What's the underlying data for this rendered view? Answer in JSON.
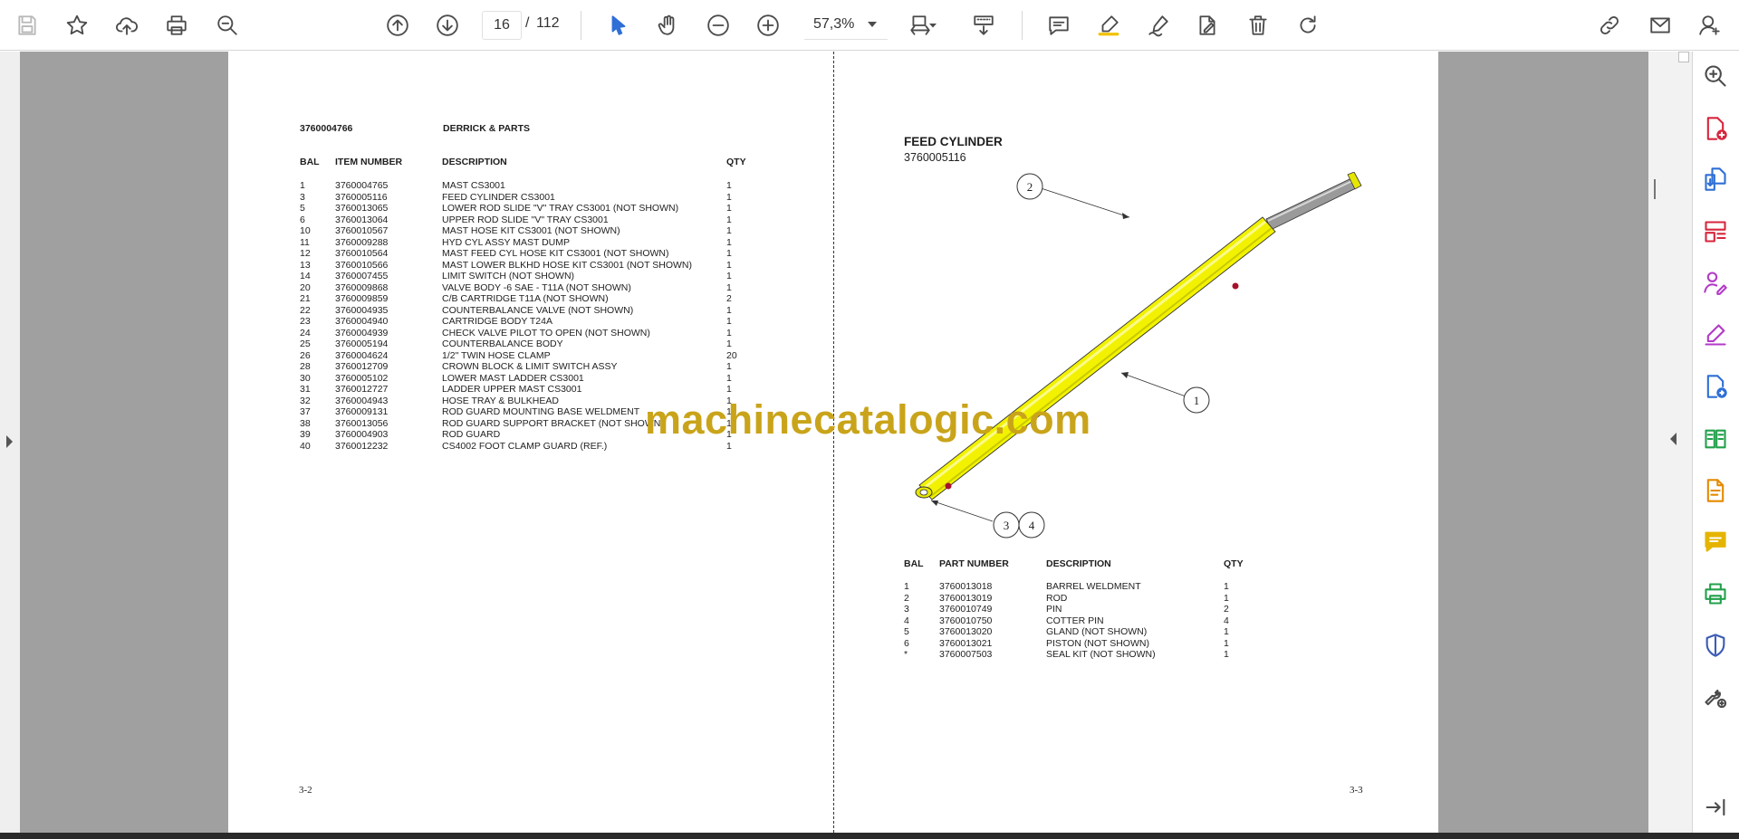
{
  "toolbar": {
    "current_page": "16",
    "page_separator": "/",
    "total_pages": "112",
    "zoom": "57,3%"
  },
  "left_page": {
    "header_code": "3760004766",
    "header_title": "DERRICK & PARTS",
    "columns": [
      "BAL",
      "ITEM NUMBER",
      "DESCRIPTION",
      "QTY"
    ],
    "rows": [
      {
        "bal": "1",
        "item": "3760004765",
        "desc": "MAST CS3001",
        "qty": "1"
      },
      {
        "bal": "3",
        "item": "3760005116",
        "desc": "FEED CYLINDER CS3001",
        "qty": "1"
      },
      {
        "bal": "5",
        "item": "3760013065",
        "desc": "LOWER ROD SLIDE \"V\" TRAY CS3001 (NOT SHOWN)",
        "qty": "1"
      },
      {
        "bal": "6",
        "item": "3760013064",
        "desc": "UPPER ROD SLIDE \"V\" TRAY CS3001",
        "qty": "1"
      },
      {
        "bal": "10",
        "item": "3760010567",
        "desc": "MAST HOSE KIT CS3001 (NOT SHOWN)",
        "qty": "1"
      },
      {
        "bal": "11",
        "item": "3760009288",
        "desc": "HYD CYL ASSY MAST DUMP",
        "qty": "1"
      },
      {
        "bal": "12",
        "item": "3760010564",
        "desc": "MAST FEED CYL HOSE KIT CS3001 (NOT SHOWN)",
        "qty": "1"
      },
      {
        "bal": "13",
        "item": "3760010566",
        "desc": "MAST LOWER BLKHD HOSE KIT CS3001 (NOT SHOWN)",
        "qty": "1"
      },
      {
        "bal": "14",
        "item": "3760007455",
        "desc": "LIMIT SWITCH (NOT SHOWN)",
        "qty": "1"
      },
      {
        "bal": "20",
        "item": "3760009868",
        "desc": "VALVE BODY -6 SAE - T11A (NOT SHOWN)",
        "qty": "1"
      },
      {
        "bal": "21",
        "item": "3760009859",
        "desc": "C/B CARTRIDGE T11A (NOT SHOWN)",
        "qty": "2"
      },
      {
        "bal": "22",
        "item": "3760004935",
        "desc": "COUNTERBALANCE VALVE (NOT SHOWN)",
        "qty": "1"
      },
      {
        "bal": "23",
        "item": "3760004940",
        "desc": "CARTRIDGE BODY T24A",
        "qty": "1"
      },
      {
        "bal": "24",
        "item": "3760004939",
        "desc": "CHECK VALVE PILOT TO OPEN (NOT SHOWN)",
        "qty": "1"
      },
      {
        "bal": "25",
        "item": "3760005194",
        "desc": "COUNTERBALANCE BODY",
        "qty": "1"
      },
      {
        "bal": "26",
        "item": "3760004624",
        "desc": "1/2\" TWIN HOSE CLAMP",
        "qty": "20"
      },
      {
        "bal": "28",
        "item": "3760012709",
        "desc": "CROWN BLOCK & LIMIT SWITCH ASSY",
        "qty": "1"
      },
      {
        "bal": "30",
        "item": "3760005102",
        "desc": "LOWER MAST LADDER CS3001",
        "qty": "1"
      },
      {
        "bal": "31",
        "item": "3760012727",
        "desc": "LADDER UPPER MAST CS3001",
        "qty": "1"
      },
      {
        "bal": "32",
        "item": "3760004943",
        "desc": "HOSE TRAY & BULKHEAD",
        "qty": "1"
      },
      {
        "bal": "37",
        "item": "3760009131",
        "desc": "ROD GUARD MOUNTING BASE WELDMENT",
        "qty": "1"
      },
      {
        "bal": "38",
        "item": "3760013056",
        "desc": "ROD GUARD SUPPORT BRACKET (NOT SHOWN)",
        "qty": "1"
      },
      {
        "bal": "39",
        "item": "3760004903",
        "desc": "ROD GUARD",
        "qty": "1"
      },
      {
        "bal": "40",
        "item": "3760012232",
        "desc": "CS4002 FOOT CLAMP GUARD (REF.)",
        "qty": "1"
      }
    ],
    "page_number": "3-2"
  },
  "right_page": {
    "title": "FEED CYLINDER",
    "code": "3760005116",
    "callouts": [
      "1",
      "2",
      "3",
      "4"
    ],
    "columns": [
      "BAL",
      "PART NUMBER",
      "DESCRIPTION",
      "QTY"
    ],
    "rows": [
      {
        "bal": "1",
        "item": "3760013018",
        "desc": "BARREL WELDMENT",
        "qty": "1"
      },
      {
        "bal": "2",
        "item": "3760013019",
        "desc": "ROD",
        "qty": "1"
      },
      {
        "bal": "3",
        "item": "3760010749",
        "desc": "PIN",
        "qty": "2"
      },
      {
        "bal": "4",
        "item": "3760010750",
        "desc": "COTTER PIN",
        "qty": "4"
      },
      {
        "bal": "5",
        "item": "3760013020",
        "desc": "GLAND (NOT SHOWN)",
        "qty": "1"
      },
      {
        "bal": "6",
        "item": "3760013021",
        "desc": "PISTON (NOT SHOWN)",
        "qty": "1"
      },
      {
        "bal": "*",
        "item": "3760007503",
        "desc": "SEAL KIT (NOT SHOWN)",
        "qty": "1"
      }
    ],
    "page_number": "3-3"
  },
  "watermark": "machinecatalogic.com",
  "colors": {
    "cylinder": "#f2f200",
    "watermark": "#c9a41a",
    "viewer_bg": "#a0a0a0",
    "rail_red": "#d7263d",
    "rail_blue": "#2f6fd6",
    "rail_purple": "#b23ac7",
    "rail_orange": "#e58a00",
    "rail_yellow": "#e5b400",
    "rail_green": "#22a04b",
    "rail_navy": "#3b5bb5"
  },
  "icons": {
    "toolbar": [
      "save-icon",
      "bookmark-star-icon",
      "upload-cloud-icon",
      "print-icon",
      "find-icon",
      "page-up-icon",
      "page-down-icon",
      "select-cursor-icon",
      "hand-icon",
      "zoom-out-icon",
      "zoom-in-icon",
      "page-fit-icon",
      "scroll-mode-icon",
      "comment-icon",
      "highlight-icon",
      "sign-icon",
      "edit-doc-icon",
      "delete-icon",
      "redo-icon",
      "share-link-icon",
      "email-icon",
      "account-icon"
    ],
    "rail": [
      "zoom-pane-icon",
      "create-pdf-icon",
      "export-pdf-icon",
      "organize-pages-icon",
      "request-signature-icon",
      "fill-sign-icon",
      "send-review-icon",
      "compare-icon",
      "scan-ocr-icon",
      "comment-tool-icon",
      "print-production-icon",
      "protect-icon",
      "more-tools-icon",
      "collapse-rail-icon"
    ]
  }
}
